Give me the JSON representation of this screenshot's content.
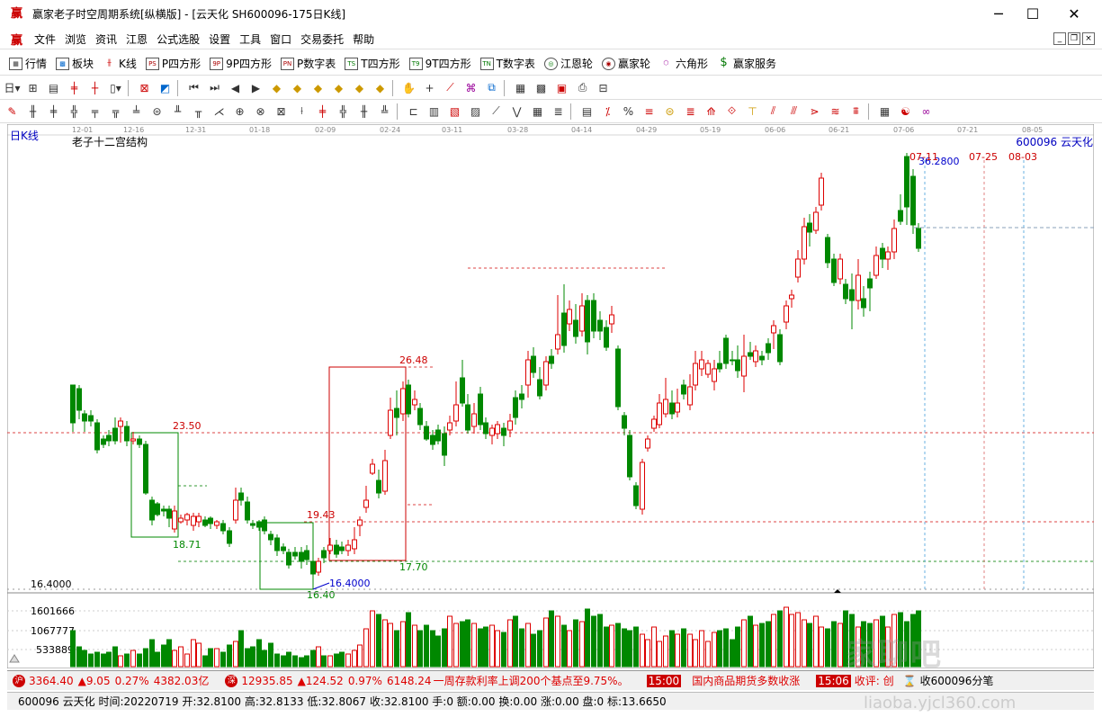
{
  "window": {
    "title": "赢家老子时空周期系统[纵横版] - [云天化  SH600096-175日K线]",
    "minimize": "─",
    "maximize": "☐",
    "close": "✕"
  },
  "menu": [
    "文件",
    "浏览",
    "资讯",
    "江恩",
    "公式选股",
    "设置",
    "工具",
    "窗口",
    "交易委托",
    "帮助"
  ],
  "toolbar1": [
    "行情",
    "板块",
    "K线",
    "P四方形",
    "9P四方形",
    "P数字表",
    "T四方形",
    "9T四方形",
    "T数字表",
    "江恩轮",
    "赢家轮",
    "六角形",
    "赢家服务"
  ],
  "toolbar1_icons": [
    "PS",
    "9P",
    "PN",
    "TS",
    "T9",
    "TN"
  ],
  "chart": {
    "period_label": "日K线",
    "indicator_label": "老子十二宫结构",
    "stock_label": "600096  云天化",
    "date_ticks": [
      "12-01",
      "12-16",
      "12-31",
      "01-18",
      "02-09",
      "02-24",
      "03-11",
      "03-28",
      "04-14",
      "04-29",
      "05-19",
      "06-06",
      "06-21",
      "07-06",
      "07-21",
      "08-05"
    ],
    "price_left_label": "16.4000",
    "annotations": {
      "p2350": "23.50",
      "p1871": "18.71",
      "p2648": "26.48",
      "p1943": "19.43",
      "p1770": "17.70",
      "p1640": "16.40",
      "p164000": "16.4000",
      "p362800": "36.2800",
      "d0711": "07-11",
      "d0725": "07-25",
      "d0803": "08-03"
    },
    "volume_ticks": [
      "1601666",
      "1067777",
      "533889"
    ]
  },
  "chart_data": {
    "type": "candlestick",
    "symbol": "600096",
    "name": "云天化",
    "levels": [
      23.5,
      18.71,
      26.48,
      19.43,
      17.7,
      16.4,
      36.28
    ]
  },
  "status": {
    "sh_index": "3364.40",
    "sh_change": "▲9.05",
    "sh_pct": "0.27%",
    "sh_amount": "4382.03亿",
    "sz_index": "12935.85",
    "sz_change": "▲124.52",
    "sz_pct": "0.97%",
    "sz_amount": "6148.24",
    "news1": "一周存款利率上调200个基点至9.75%。",
    "time1": "15:00",
    "news2": "国内商品期货多数收涨",
    "time2": "15:06",
    "news3": "收评: 创",
    "alert": "收600096分笔"
  },
  "info": "600096  云天化  时间:20220719  开:32.8100  高:32.8133  低:32.8067  收:32.8100  手:0  额:0.00  换:0.00  涨:0.00  盘:0  标:13.6650",
  "watermark": "家聊吧",
  "watermark2": "liaoba.yjcl360.com"
}
